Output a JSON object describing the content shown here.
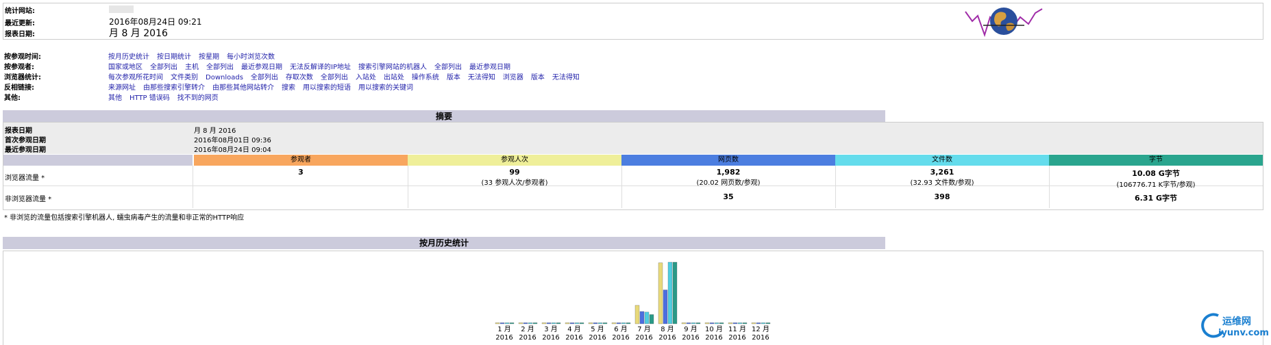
{
  "header": {
    "rows": [
      {
        "label": "统计网站:",
        "value": ""
      },
      {
        "label": "最近更新:",
        "value": "2016年08月24日 09:21"
      },
      {
        "label": "报表日期:",
        "value": "月 8 月 2016"
      }
    ]
  },
  "nav": [
    {
      "label": "按参观时间:",
      "links": [
        "按月历史统计",
        "按日期统计",
        "按星期",
        "每小时浏览次数"
      ]
    },
    {
      "label": "按参观者:",
      "links": [
        "国家或地区",
        "全部列出",
        "主机",
        "全部列出",
        "最近参观日期",
        "无法反解译的IP地址",
        "搜索引擎网站的机器人",
        "全部列出",
        "最近参观日期"
      ]
    },
    {
      "label": "浏览器统计:",
      "links": [
        "每次参观所花时间",
        "文件类别",
        "Downloads",
        "全部列出",
        "存取次数",
        "全部列出",
        "入站处",
        "出站处",
        "操作系统",
        "版本",
        "无法得知",
        "浏览器",
        "版本",
        "无法得知"
      ]
    },
    {
      "label": "反相链接:",
      "links": [
        "来源网址",
        "由那些搜索引擎转介",
        "由那些其他网站转介",
        "搜索",
        "用以搜索的短语",
        "用以搜索的关键词"
      ]
    },
    {
      "label": "其他:",
      "links": [
        "其他",
        "HTTP 错误码",
        "找不到的网页"
      ]
    }
  ],
  "summary": {
    "title": "摘要",
    "report_date_label": "报表日期",
    "report_date": "月 8 月 2016",
    "first_visit_label": "首次参观日期",
    "first_visit": "2016年08月01日 09:36",
    "last_visit_label": "最近参观日期",
    "last_visit": "2016年08月24日 09:04",
    "columns": [
      {
        "name": "参观者",
        "color": "#f8a65e"
      },
      {
        "name": "参观人次",
        "color": "#efef99"
      },
      {
        "name": "网页数",
        "color": "#4c7ee0"
      },
      {
        "name": "文件数",
        "color": "#64dcec"
      },
      {
        "name": "字节",
        "color": "#2aa58e"
      }
    ],
    "viewed_label": "浏览器流量 *",
    "viewed": [
      {
        "main": "3",
        "sub": ""
      },
      {
        "main": "99",
        "sub": "(33 参观人次/参观者)"
      },
      {
        "main": "1,982",
        "sub": "(20.02 网页数/参观)"
      },
      {
        "main": "3,261",
        "sub": "(32.93 文件数/参观)"
      },
      {
        "main": "10.08 G字节",
        "sub": "(106776.71 K字节/参观)"
      }
    ],
    "notviewed_label": "非浏览器流量 *",
    "notviewed": [
      {
        "main": "",
        "sub": ""
      },
      {
        "main": "",
        "sub": ""
      },
      {
        "main": "35",
        "sub": ""
      },
      {
        "main": "398",
        "sub": ""
      },
      {
        "main": "6.31 G字节",
        "sub": ""
      }
    ],
    "footnote": "* 非浏览的流量包括搜索引擎机器人, 蠕虫病毒产生的流量和非正常的HTTP响应"
  },
  "history": {
    "title": "按月历史统计",
    "year": "2016"
  },
  "chart_data": {
    "type": "bar",
    "categories": [
      "1 月",
      "2 月",
      "3 月",
      "4 月",
      "5 月",
      "6 月",
      "7 月",
      "8 月",
      "9 月",
      "10 月",
      "11 月",
      "12 月"
    ],
    "series": [
      {
        "name": "参观人次",
        "color": "#e8d97a",
        "values": [
          0,
          0,
          0,
          0,
          0,
          0,
          30,
          99,
          0,
          0,
          0,
          0
        ]
      },
      {
        "name": "网页数",
        "color": "#4c6ee0",
        "values": [
          0,
          0,
          0,
          0,
          0,
          0,
          20,
          55,
          0,
          0,
          0,
          0
        ]
      },
      {
        "name": "文件数",
        "color": "#50cde0",
        "values": [
          0,
          0,
          0,
          0,
          0,
          0,
          19,
          100,
          0,
          0,
          0,
          0
        ]
      },
      {
        "name": "字节",
        "color": "#2a9a88",
        "values": [
          0,
          0,
          0,
          0,
          0,
          0,
          15,
          100,
          0,
          0,
          0,
          0
        ]
      }
    ],
    "ylim": [
      0,
      100
    ]
  },
  "watermark": {
    "line1": "运维网",
    "line2": "iyunv.com"
  }
}
